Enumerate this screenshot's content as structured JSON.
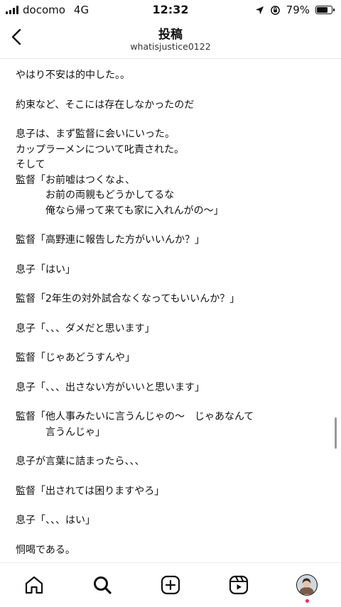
{
  "status": {
    "carrier": "docomo",
    "network": "4G",
    "time": "12:32",
    "battery_percent": "79%",
    "battery_level": 0.79,
    "icons": [
      "signal-icon",
      "location-arrow-icon",
      "orientation-lock-icon",
      "battery-icon"
    ]
  },
  "header": {
    "title": "投稿",
    "username": "whatisjustice0122",
    "back_icon": "chevron-left-icon"
  },
  "post": {
    "paragraphs": [
      [
        "やはり不安は的中した。。"
      ],
      [
        "約束など、そこには存在しなかったのだ"
      ],
      [
        "息子は、まず監督に会いにいった。",
        "カップラーメンについて叱責された。",
        "そして",
        "監督「お前嘘はつくなよ、",
        "　　　お前の両親もどうかしてるな",
        "　　　俺なら帰って来ても家に入れんがの〜」"
      ],
      [
        "監督「高野連に報告した方がいいんか？」"
      ],
      [
        "息子「はい」"
      ],
      [
        "監督「2年生の対外試合なくなってもいいんか？」"
      ],
      [
        "息子「、、、ダメだと思います」"
      ],
      [
        "監督「じゃあどうすんや」"
      ],
      [
        "息子「、、、出さない方がいいと思います」"
      ],
      [
        "監督「他人事みたいに言うんじゃの〜　じゃあなんて",
        "　　　言うんじゃ」"
      ],
      [
        "息子が言葉に詰まったら、、、"
      ],
      [
        "監督「出されては困りますやろ」"
      ],
      [
        "息子「、、、はい」"
      ],
      [
        "恫喝である。"
      ]
    ]
  },
  "tab_bar": {
    "items": [
      {
        "name": "home",
        "icon": "home-icon"
      },
      {
        "name": "search",
        "icon": "search-icon",
        "active": true
      },
      {
        "name": "create",
        "icon": "plus-square-icon"
      },
      {
        "name": "reels",
        "icon": "reels-icon"
      },
      {
        "name": "profile",
        "icon": "avatar"
      }
    ]
  },
  "colors": {
    "text": "#111111",
    "divider": "#e6e6e6",
    "notification": "#ff1f4b"
  }
}
